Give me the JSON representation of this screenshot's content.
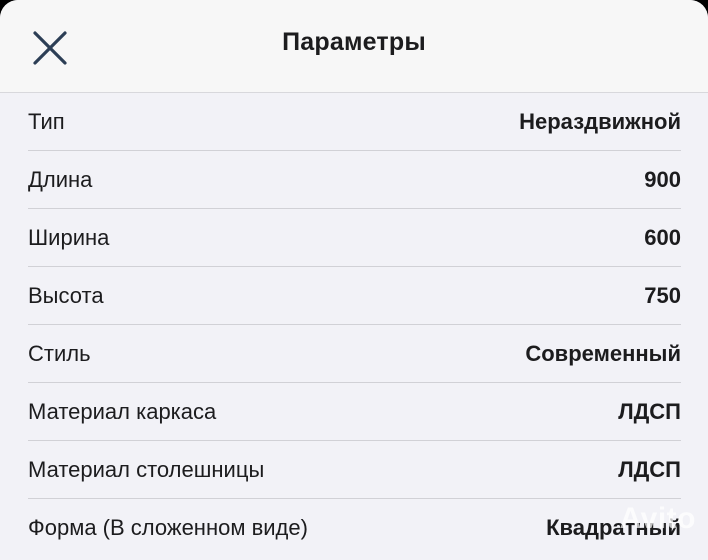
{
  "header": {
    "title": "Параметры",
    "close_icon": "close-icon"
  },
  "params": [
    {
      "label": "Тип",
      "value": "Нераздвижной"
    },
    {
      "label": "Длина",
      "value": "900"
    },
    {
      "label": "Ширина",
      "value": "600"
    },
    {
      "label": "Высота",
      "value": "750"
    },
    {
      "label": "Стиль",
      "value": "Современный"
    },
    {
      "label": "Материал каркаса",
      "value": "ЛДСП"
    },
    {
      "label": "Материал столешницы",
      "value": "ЛДСП"
    },
    {
      "label": "Форма (В сложенном виде)",
      "value": "Квадратный"
    }
  ],
  "watermark": "Avito"
}
